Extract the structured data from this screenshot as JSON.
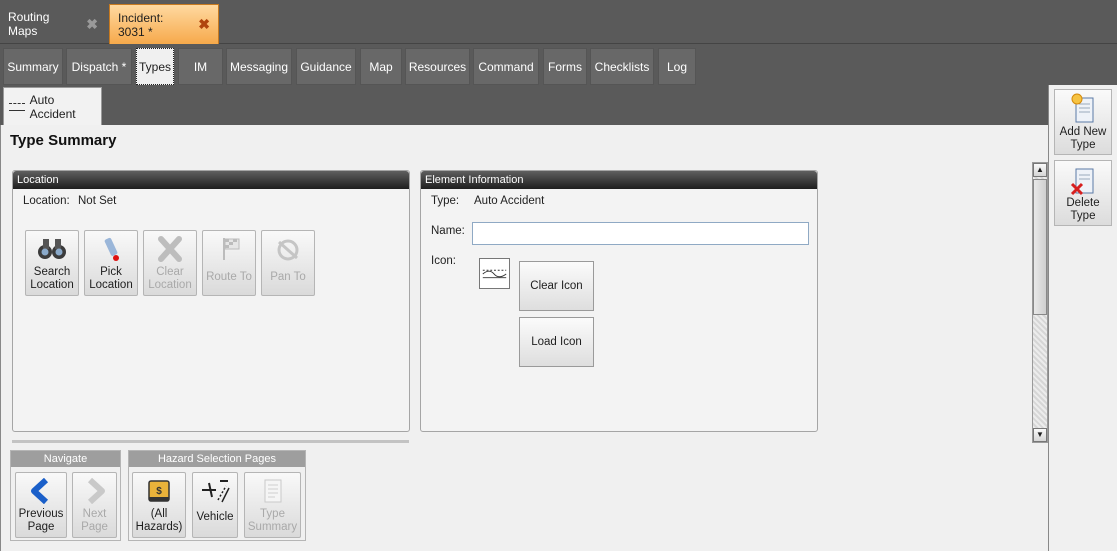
{
  "doc_tabs": [
    {
      "label": "Routing Maps",
      "close": "✖"
    },
    {
      "label": "Incident: 3031 *",
      "close": "✖"
    }
  ],
  "nav_tabs": [
    "Summary",
    "Dispatch *",
    "Types",
    "IM",
    "Messaging",
    "Guidance",
    "Map",
    "Resources",
    "Command",
    "Forms",
    "Checklists",
    "Log"
  ],
  "sub_tab": {
    "label": "Auto Accident"
  },
  "page_title": "Type Summary",
  "location_panel": {
    "title": "Location",
    "location_label": "Location:",
    "location_value": "Not Set",
    "buttons": [
      {
        "label": "Search Location",
        "enabled": true,
        "icon": "binoculars-icon"
      },
      {
        "label": "Pick Location",
        "enabled": true,
        "icon": "pointer-pen-icon"
      },
      {
        "label": "Clear Location",
        "enabled": false,
        "icon": "clear-x-icon"
      },
      {
        "label": "Route To",
        "enabled": false,
        "icon": "checkered-flag-icon"
      },
      {
        "label": "Pan To",
        "enabled": false,
        "icon": "pan-hand-icon"
      }
    ]
  },
  "element_panel": {
    "title": "Element Information",
    "type_label": "Type:",
    "type_value": "Auto Accident",
    "name_label": "Name:",
    "name_value": "",
    "icon_label": "Icon:",
    "clear_icon": "Clear Icon",
    "load_icon": "Load Icon"
  },
  "navigate": {
    "title": "Navigate",
    "previous": "Previous Page",
    "next": "Next Page"
  },
  "hazard": {
    "title": "Hazard Selection Pages",
    "all": "(All Hazards)",
    "vehicle": "Vehicle",
    "summary": "Type Summary"
  },
  "rail": {
    "add": "Add New Type",
    "delete": "Delete Type"
  },
  "colors": {
    "active_tab": "#f6a94b",
    "panel_header": "#1e1e1e",
    "nav_bg": "#5a5a5a"
  }
}
